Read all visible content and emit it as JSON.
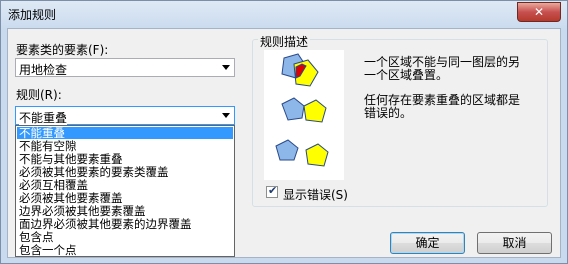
{
  "window": {
    "title": "添加规则",
    "close_glyph": "✕"
  },
  "feature_class": {
    "label": "要素类的要素(F):",
    "value": "用地检查"
  },
  "rule": {
    "label": "规则(R):",
    "value": "不能重叠"
  },
  "rule_options": [
    "不能重叠",
    "不能有空隙",
    "不能与其他要素重叠",
    "必须被其他要素的要素类覆盖",
    "必须互相覆盖",
    "必须被其他要素覆盖",
    "边界必须被其他要素覆盖",
    "面边界必须被其他要素的边界覆盖",
    "包含点",
    "包含一个点"
  ],
  "description": {
    "group_title": "规则描述",
    "line1": "一个区域不能与同一图层的另",
    "line2": "一个区域叠置。",
    "line3": "任何存在要素重叠的区域都是",
    "line4": "错误的。"
  },
  "show_errors": {
    "label": "显示错误(S)",
    "checked": true
  },
  "buttons": {
    "ok": "确定",
    "cancel": "取消"
  },
  "colors": {
    "shape_blue": "#8db7e8",
    "shape_yellow": "#ffff00",
    "error_red": "#e00000"
  }
}
